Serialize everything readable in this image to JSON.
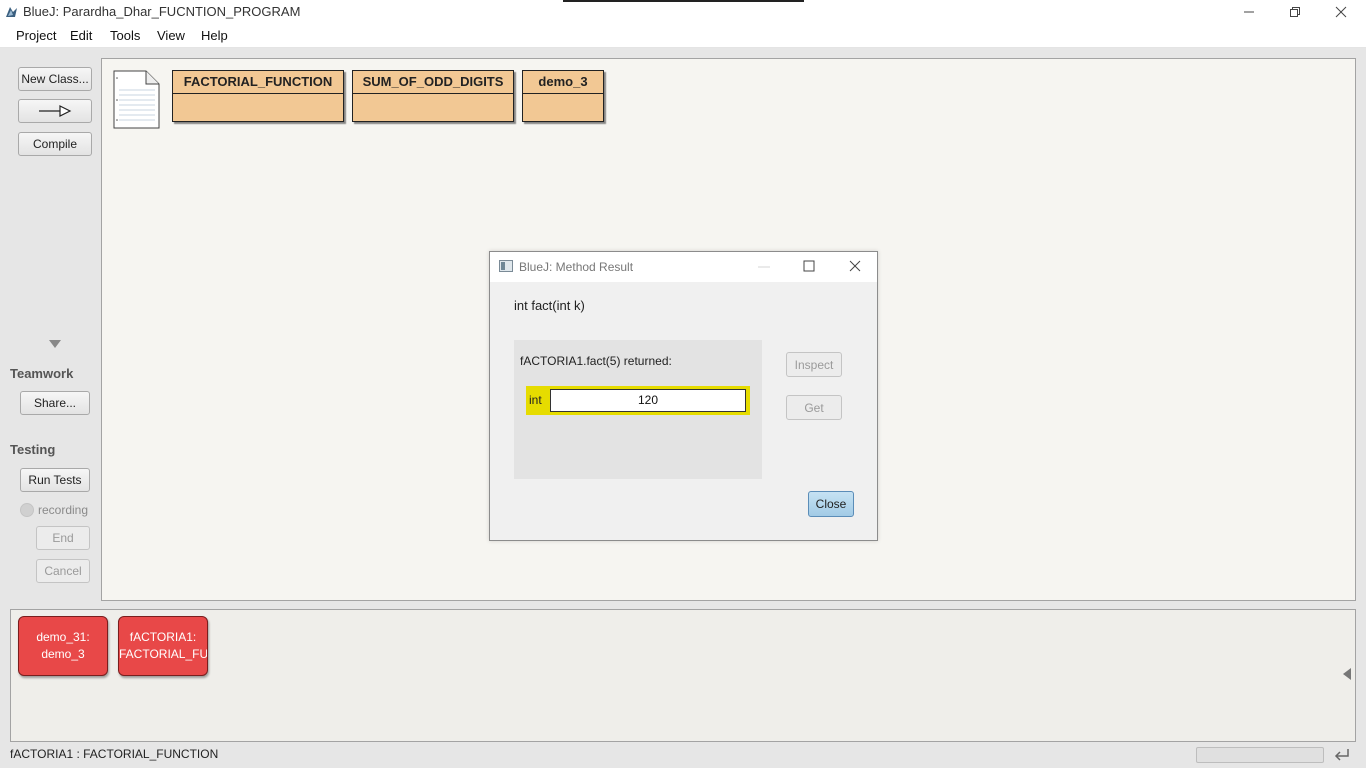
{
  "window": {
    "title": "BlueJ:  Parardha_Dhar_FUCNTION_PROGRAM"
  },
  "menu": [
    "Project",
    "Edit",
    "Tools",
    "View",
    "Help"
  ],
  "sidebar": {
    "new_class": "New Class...",
    "compile": "Compile",
    "teamwork_label": "Teamwork",
    "share": "Share...",
    "testing_label": "Testing",
    "run_tests": "Run Tests",
    "recording": "recording",
    "end": "End",
    "cancel": "Cancel"
  },
  "classes": [
    "FACTORIAL_FUNCTION",
    "SUM_OF_ODD_DIGITS",
    "demo_3"
  ],
  "objects": [
    {
      "line1": "demo_31:",
      "line2": "demo_3"
    },
    {
      "line1": "fACTORIA1:",
      "line2": "FACTORIAL_FU..."
    }
  ],
  "status": "fACTORIA1 : FACTORIAL_FUNCTION",
  "dialog": {
    "title": "BlueJ:  Method Result",
    "signature": "int fact(int k)",
    "call_text": "fACTORIA1.fact(5) returned:",
    "type_label": "int",
    "value": "120",
    "inspect": "Inspect",
    "get": "Get",
    "close": "Close"
  },
  "colors": {
    "class_fill": "#f2c894",
    "object_fill": "#e84848",
    "result_highlight": "#e6dc00",
    "close_button": "#aed2ea"
  }
}
